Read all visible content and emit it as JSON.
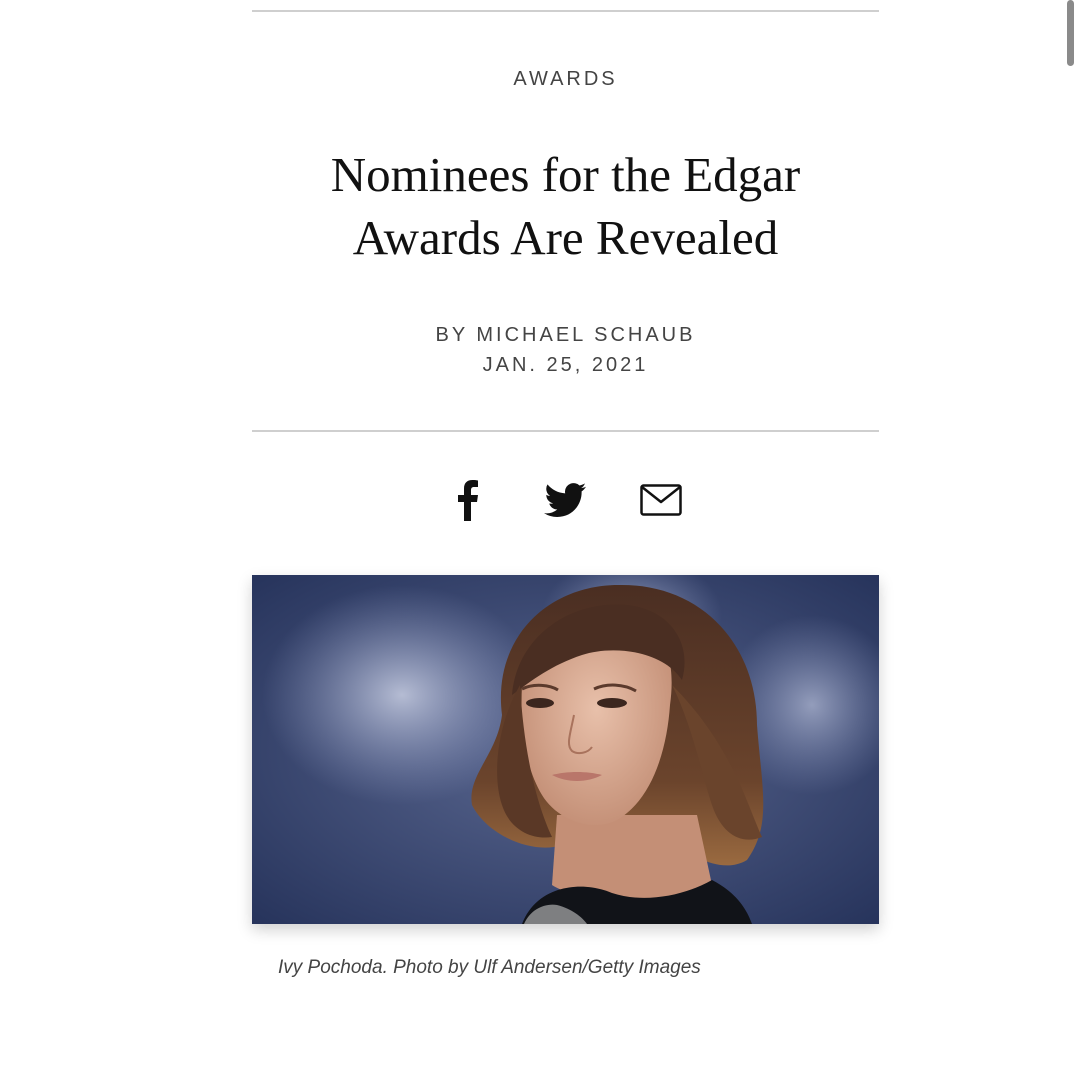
{
  "article": {
    "kicker": "AWARDS",
    "headline_line1": "Nominees for the Edgar",
    "headline_line2": "Awards Are Revealed",
    "byline": "BY MICHAEL SCHAUB",
    "date": "JAN. 25, 2021"
  },
  "share": {
    "icons": [
      "facebook-icon",
      "twitter-icon",
      "email-icon"
    ]
  },
  "photo": {
    "caption": "Ivy Pochoda. Photo by Ulf Andersen/Getty Images"
  }
}
